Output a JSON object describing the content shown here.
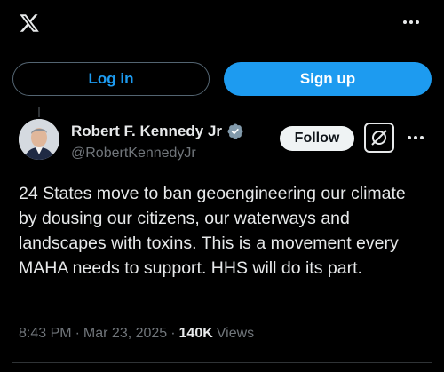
{
  "header": {
    "logo_icon": "x-logo-icon",
    "more_icon": "more-horizontal-icon"
  },
  "auth": {
    "login_label": "Log in",
    "signup_label": "Sign up"
  },
  "tweet": {
    "author_name": "Robert F. Kennedy Jr",
    "handle": "@RobertKennedyJr",
    "verified_icon": "verified-badge-icon",
    "follow_label": "Follow",
    "grok_icon": "grok-icon",
    "more_icon": "more-horizontal-icon",
    "text": "24 States move to ban geoengineering our climate by dousing our citizens, our waterways and landscapes with toxins. This is a movement every MAHA needs to support. HHS will do its part.",
    "time": "8:43 PM",
    "separator": "·",
    "date": "Mar 23, 2025",
    "views_count": "140K",
    "views_label": "Views"
  },
  "colors": {
    "background": "#000000",
    "accent": "#1d9bf0",
    "text": "#e7e9ea",
    "muted": "#71767b"
  }
}
